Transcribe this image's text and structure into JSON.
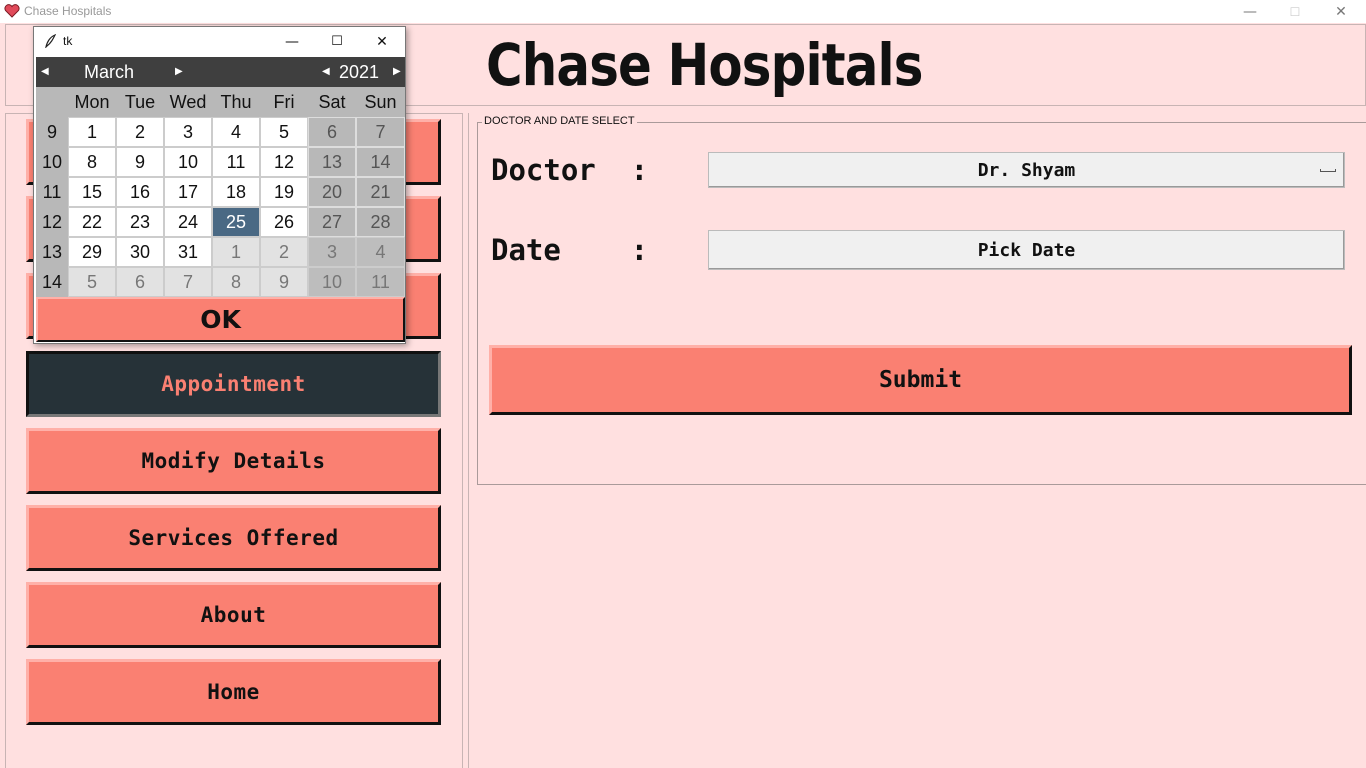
{
  "window": {
    "title": "Chase Hospitals",
    "minimize": "—",
    "maximize": "☐",
    "close": "✕"
  },
  "header": {
    "title": "Chase Hospitals"
  },
  "nav": {
    "appointment": "Appointment",
    "modify_details": "Modify Details",
    "services_offered": "Services Offered",
    "about": "About",
    "home": "Home"
  },
  "form": {
    "legend": "DOCTOR AND DATE SELECT",
    "doctor_label": "Doctor  :",
    "doctor_value": "Dr. Shyam",
    "date_label": "Date    :",
    "date_button": "Pick Date",
    "submit": "Submit"
  },
  "popup": {
    "title": "tk",
    "minimize": "—",
    "maximize": "☐",
    "close": "✕",
    "month": "March",
    "year": "2021",
    "day_names": [
      "Mon",
      "Tue",
      "Wed",
      "Thu",
      "Fri",
      "Sat",
      "Sun"
    ],
    "weeks": [
      {
        "num": "9",
        "days": [
          "1",
          "2",
          "3",
          "4",
          "5",
          "6",
          "7"
        ],
        "types": [
          "n",
          "n",
          "n",
          "n",
          "n",
          "w",
          "w"
        ]
      },
      {
        "num": "10",
        "days": [
          "8",
          "9",
          "10",
          "11",
          "12",
          "13",
          "14"
        ],
        "types": [
          "n",
          "n",
          "n",
          "n",
          "n",
          "w",
          "w"
        ]
      },
      {
        "num": "11",
        "days": [
          "15",
          "16",
          "17",
          "18",
          "19",
          "20",
          "21"
        ],
        "types": [
          "n",
          "n",
          "n",
          "n",
          "n",
          "w",
          "w"
        ]
      },
      {
        "num": "12",
        "days": [
          "22",
          "23",
          "24",
          "25",
          "26",
          "27",
          "28"
        ],
        "types": [
          "n",
          "n",
          "n",
          "s",
          "n",
          "w",
          "w"
        ]
      },
      {
        "num": "13",
        "days": [
          "29",
          "30",
          "31",
          "1",
          "2",
          "3",
          "4"
        ],
        "types": [
          "n",
          "n",
          "n",
          "o",
          "o",
          "ow",
          "ow"
        ]
      },
      {
        "num": "14",
        "days": [
          "5",
          "6",
          "7",
          "8",
          "9",
          "10",
          "11"
        ],
        "types": [
          "o",
          "o",
          "o",
          "o",
          "o",
          "ow",
          "ow"
        ]
      }
    ],
    "selected_day": "25",
    "ok": "OK"
  },
  "colors": {
    "background": "#ffe0e0",
    "button": "#fa8072",
    "active_button": "#263238",
    "selected_day": "#4a6984"
  }
}
